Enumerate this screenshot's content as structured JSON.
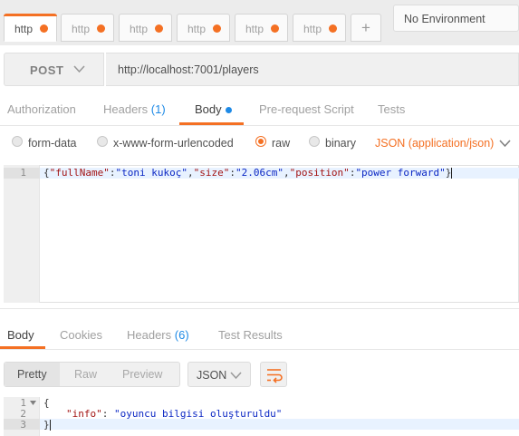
{
  "tabs": [
    {
      "label": "http",
      "active": true
    },
    {
      "label": "http",
      "active": false
    },
    {
      "label": "http",
      "active": false
    },
    {
      "label": "http",
      "active": false
    },
    {
      "label": "http",
      "active": false
    },
    {
      "label": "http",
      "active": false
    }
  ],
  "add_tab_label": "+",
  "environment": {
    "selected": "No Environment"
  },
  "request": {
    "method": "POST",
    "url": "http://localhost:7001/players",
    "tabs": {
      "authorization": "Authorization",
      "headers": "Headers",
      "headers_count": "(1)",
      "body": "Body",
      "prerequest": "Pre-request Script",
      "tests": "Tests"
    },
    "body_types": {
      "form_data": "form-data",
      "urlencoded": "x-www-form-urlencoded",
      "raw": "raw",
      "binary": "binary",
      "selected": "raw"
    },
    "content_type": "JSON (application/json)",
    "editor": {
      "line_numbers": [
        "1"
      ],
      "tokens": {
        "open": "{",
        "k1": "\"fullName\"",
        "v1": "\"toni kukoç\"",
        "k2": "\"size\"",
        "v2": "\"2.06cm\"",
        "k3": "\"position\"",
        "v3": "\"power forward\"",
        "close": "}"
      }
    }
  },
  "response": {
    "tabs": {
      "body": "Body",
      "cookies": "Cookies",
      "headers": "Headers",
      "headers_count": "(6)",
      "test_results": "Test Results"
    },
    "view_modes": {
      "pretty": "Pretty",
      "raw": "Raw",
      "preview": "Preview",
      "selected": "Pretty"
    },
    "format": "JSON",
    "editor": {
      "line_numbers": [
        "1",
        "2",
        "3"
      ],
      "open": "{",
      "key": "\"info\"",
      "value": "\"oyuncu bilgisi oluşturuldu\"",
      "close": "}"
    }
  },
  "colors": {
    "accent": "#f47023",
    "link_blue": "#1e8ae6",
    "key_red": "#a31515",
    "string_blue": "#0b27c4"
  },
  "icons": {
    "method_dropdown": "chevron-down-icon",
    "content_type_dropdown": "chevron-down-icon",
    "format_dropdown": "chevron-down-icon",
    "wrap": "wrap-lines-icon",
    "fold": "fold-arrow-icon"
  }
}
